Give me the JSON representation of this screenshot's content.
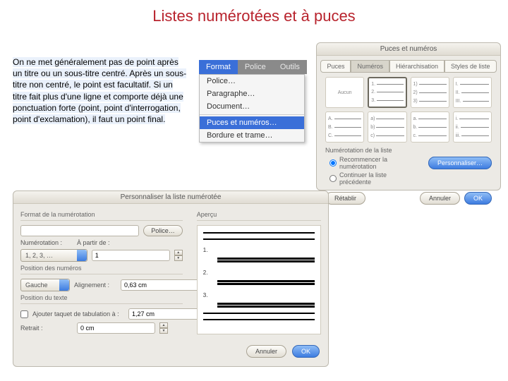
{
  "title": "Listes numérotées et à puces",
  "body_text": "On ne met généralement pas de point après un titre ou un sous-titre centré.\nAprès un sous-titre non centré, le point est facultatif.\nSi un titre fait plus d'une ligne et comporte déjà une ponctuation forte (point, point d'interrogation, point d'exclamation), il faut un point final.",
  "menu": {
    "tabs": [
      "Format",
      "Police",
      "Outils"
    ],
    "items": [
      "Police…",
      "Paragraphe…",
      "Document…"
    ],
    "highlighted": "Puces et numéros…",
    "after": "Bordure et trame…"
  },
  "dlg1": {
    "title": "Puces et numéros",
    "tabs": [
      "Puces",
      "Numéros",
      "Hiérarchisation",
      "Styles de liste"
    ],
    "cells": [
      "Aucun",
      [
        "1.",
        "2.",
        "3."
      ],
      [
        "1)",
        "2)",
        "3)"
      ],
      [
        "I.",
        "II.",
        "III."
      ],
      [
        "A.",
        "B.",
        "C."
      ],
      [
        "a)",
        "b)",
        "c)"
      ],
      [
        "a.",
        "b.",
        "c."
      ],
      [
        "i.",
        "ii.",
        "iii."
      ]
    ],
    "num_section": "Numérotation de la liste",
    "radio1": "Recommencer la numérotation",
    "radio2": "Continuer la liste précédente",
    "personnaliser": "Personnaliser…",
    "retablir": "Rétablir",
    "annuler": "Annuler",
    "ok": "OK"
  },
  "dlg2": {
    "title": "Personnaliser la liste numérotée",
    "format_grp": "Format de la numérotation",
    "police_btn": "Police…",
    "numerotation_lbl": "Numérotation :",
    "numerotation_val": "1, 2, 3, …",
    "apartir_lbl": "À partir de :",
    "apartir_val": "1",
    "pos_num_grp": "Position des numéros",
    "position_val": "Gauche",
    "alignement_lbl": "Alignement :",
    "alignement_val": "0,63 cm",
    "pos_text_grp": "Position du texte",
    "tab_chk_lbl": "Ajouter taquet de tabulation à :",
    "tab_val": "1,27 cm",
    "retrait_lbl": "Retrait :",
    "retrait_val": "0 cm",
    "apercu": "Aperçu",
    "annuler": "Annuler",
    "ok": "OK"
  }
}
